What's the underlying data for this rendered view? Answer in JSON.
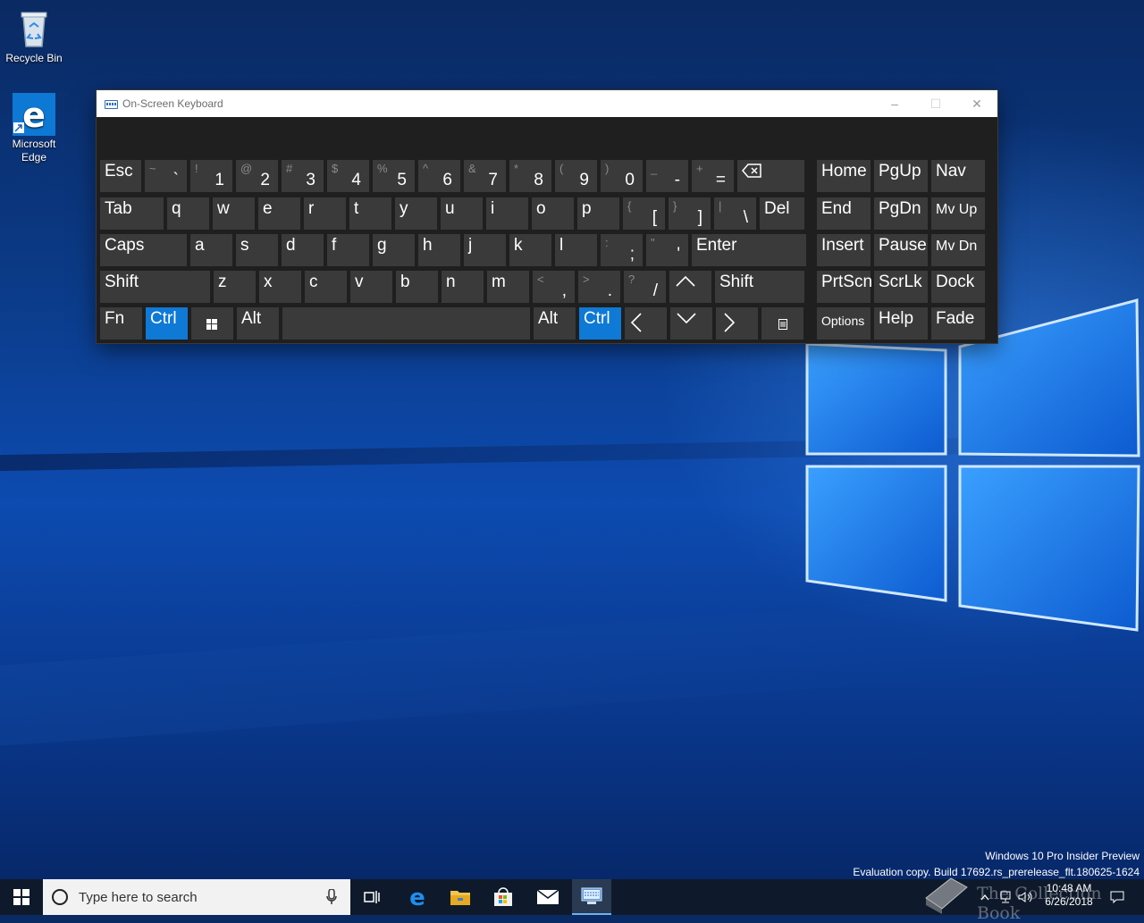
{
  "desktop": {
    "icons": [
      {
        "label": "Recycle Bin"
      },
      {
        "label": "Microsoft Edge"
      }
    ],
    "watermark": {
      "line1": "Windows 10 Pro Insider Preview",
      "line2": "Evaluation copy. Build 17692.rs_prerelease_flt.180625-1624"
    },
    "overlay_text": "The Collection Book"
  },
  "osk": {
    "title": "On-Screen Keyboard",
    "controls": {
      "minimize": "–",
      "maximize": "☐",
      "close": "✕"
    },
    "rows": [
      [
        {
          "label": "Esc"
        },
        {
          "shift": "~",
          "char": "`"
        },
        {
          "shift": "!",
          "char": "1"
        },
        {
          "shift": "@",
          "char": "2"
        },
        {
          "shift": "#",
          "char": "3"
        },
        {
          "shift": "$",
          "char": "4"
        },
        {
          "shift": "%",
          "char": "5"
        },
        {
          "shift": "^",
          "char": "6"
        },
        {
          "shift": "&",
          "char": "7"
        },
        {
          "shift": "*",
          "char": "8"
        },
        {
          "shift": "(",
          "char": "9"
        },
        {
          "shift": ")",
          "char": "0"
        },
        {
          "shift": "_",
          "char": "-"
        },
        {
          "shift": "+",
          "char": "="
        },
        {
          "icon": "backspace-icon"
        },
        {
          "label": "Home"
        },
        {
          "label": "PgUp"
        },
        {
          "label": "Nav"
        }
      ],
      [
        {
          "label": "Tab"
        },
        {
          "label": "q"
        },
        {
          "label": "w"
        },
        {
          "label": "e"
        },
        {
          "label": "r"
        },
        {
          "label": "t"
        },
        {
          "label": "y"
        },
        {
          "label": "u"
        },
        {
          "label": "i"
        },
        {
          "label": "o"
        },
        {
          "label": "p"
        },
        {
          "shift": "{",
          "char": "["
        },
        {
          "shift": "}",
          "char": "]"
        },
        {
          "shift": "|",
          "char": "\\"
        },
        {
          "label": "Del"
        },
        {
          "label": "End"
        },
        {
          "label": "PgDn"
        },
        {
          "label": "Mv Up"
        }
      ],
      [
        {
          "label": "Caps"
        },
        {
          "label": "a"
        },
        {
          "label": "s"
        },
        {
          "label": "d"
        },
        {
          "label": "f"
        },
        {
          "label": "g"
        },
        {
          "label": "h"
        },
        {
          "label": "j"
        },
        {
          "label": "k"
        },
        {
          "label": "l"
        },
        {
          "shift": ":",
          "char": ";"
        },
        {
          "shift": "\"",
          "char": "'"
        },
        {
          "label": "Enter"
        },
        {
          "label": "Insert"
        },
        {
          "label": "Pause"
        },
        {
          "label": "Mv Dn"
        }
      ],
      [
        {
          "label": "Shift"
        },
        {
          "label": "z"
        },
        {
          "label": "x"
        },
        {
          "label": "c"
        },
        {
          "label": "v"
        },
        {
          "label": "b"
        },
        {
          "label": "n"
        },
        {
          "label": "m"
        },
        {
          "shift": "<",
          "char": ","
        },
        {
          "shift": ">",
          "char": "."
        },
        {
          "shift": "?",
          "char": "/"
        },
        {
          "icon": "arrow-up-icon"
        },
        {
          "label": "Shift"
        },
        {
          "label": "PrtScn"
        },
        {
          "label": "ScrLk"
        },
        {
          "label": "Dock"
        }
      ],
      [
        {
          "label": "Fn"
        },
        {
          "label": "Ctrl",
          "active": true
        },
        {
          "icon": "windows-key-icon"
        },
        {
          "label": "Alt"
        },
        {
          "icon": "spacebar"
        },
        {
          "label": "Alt"
        },
        {
          "label": "Ctrl",
          "active": true
        },
        {
          "icon": "arrow-left-icon"
        },
        {
          "icon": "arrow-down-icon"
        },
        {
          "icon": "arrow-right-icon"
        },
        {
          "icon": "context-menu-icon"
        },
        {
          "label": "Options"
        },
        {
          "label": "Help"
        },
        {
          "label": "Fade"
        }
      ]
    ]
  },
  "taskbar": {
    "search_placeholder": "Type here to search",
    "clock_time": "10:48 AM",
    "clock_date": "6/26/2018",
    "apps": [
      "task-view-icon",
      "edge-icon",
      "file-explorer-icon",
      "store-icon",
      "mail-icon",
      "osk-icon"
    ]
  },
  "colors": {
    "accent": "#0f79d6",
    "key": "#3a3a3a",
    "osk_bg": "#1f1f1f",
    "taskbar": "#0e1a2b"
  }
}
